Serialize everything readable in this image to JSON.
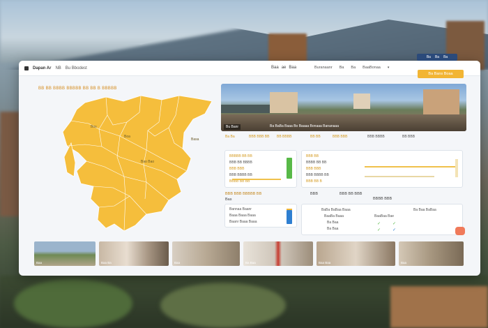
{
  "header": {
    "logo": "Dapan Ar",
    "brand_code": "NB",
    "brand": "Bu Bbodest",
    "nav_center": [
      "Baa",
      "ae",
      "Baa"
    ],
    "nav_right": [
      "Buranaanr",
      "Ba",
      "Ba",
      "BaaBonaa"
    ],
    "top_right_chips": [
      "Ba",
      "Ba",
      "Ba"
    ],
    "cta_label": "Ba Bans Boaa"
  },
  "map": {
    "title": "BB BB BBBB BBBBB BB BB B BBBBB",
    "labels": [
      "Bos",
      "Boa",
      "Bao Bao",
      "Basa"
    ],
    "fill_color": "#f5be3c"
  },
  "photo": {
    "caption": "Bu Banr",
    "caption2": "Ba BaBa Baaa Bo Baaaa Bonaaa Bananaaa"
  },
  "panels": {
    "top_labels": [
      "Ba Ba",
      "BBB BBB BB",
      "BB BBBB",
      "BB BB",
      "BBB BBB",
      "BBB BBBB",
      "BB BBB"
    ],
    "left_rows": [
      "BBBBB BB BB",
      "BBB BB BBBB",
      "BBB BBB",
      "BBB BBBB BB",
      "BBBB BB BB"
    ],
    "right_rows": [
      "BBB BB",
      "BBBB BB BB",
      "BBB BBB",
      "BBB BBBB BB",
      "BBB BB B"
    ],
    "mid_title": "BBB BBB BBBBB BB",
    "mid_labels": [
      "BBB",
      "BBB BB BBB",
      "BBBB BBB"
    ],
    "lower_left_title": "Bas",
    "lower_left_rows": [
      "Bannaa Baanr",
      "Baaa Baaa Baaa",
      "Baanr Baaa Baaa"
    ],
    "lower_right_rows": [
      "BaBa BaBaa Baaa",
      "BaaBa Baaa",
      "Ba Baa",
      "Ba Baa"
    ],
    "lower_right_right": [
      "BaaBaa Bae",
      "Ba Baa BaBaa"
    ],
    "accent_green": "#58b947",
    "accent_blue": "#2e7fd1",
    "accent_orange": "#f2b534"
  },
  "thumbnails": [
    {
      "caption": "Baa"
    },
    {
      "caption": "Baa Ba"
    },
    {
      "caption": "Baa"
    },
    {
      "caption": "Ba Baa"
    },
    {
      "caption": "Baa Baa"
    },
    {
      "caption": "Baa"
    }
  ]
}
